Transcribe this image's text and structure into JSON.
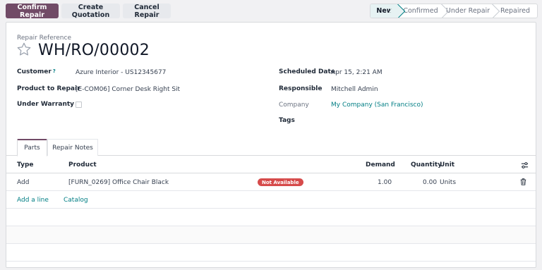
{
  "control_bar": {
    "confirm_label": "Confirm Repair",
    "create_quotation_label": "Create Quotation",
    "cancel_label": "Cancel Repair"
  },
  "status_stages": [
    "New",
    "Confirmed",
    "Under Repair",
    "Repaired"
  ],
  "active_stage": "New",
  "form": {
    "ref_label": "Repair Reference",
    "reference": "WH/RO/00002",
    "left_fields": {
      "customer_label": "Customer",
      "customer_value": "Azure Interior - US12345677",
      "product_label": "Product to Repair",
      "product_value": "[E-COM06] Corner Desk Right Sit",
      "warranty_label": "Under Warranty",
      "warranty_checked": false,
      "help_mark": "?"
    },
    "right_fields": {
      "scheduled_label": "Scheduled Date",
      "scheduled_value": "Apr 15, 2:21 AM",
      "responsible_label": "Responsible",
      "responsible_value": "Mitchell Admin",
      "company_label": "Company",
      "company_value": "My Company (San Francisco)",
      "tags_label": "Tags"
    }
  },
  "tabs": [
    "Parts",
    "Repair Notes"
  ],
  "table": {
    "headers": {
      "type": "Type",
      "product": "Product",
      "demand": "Demand",
      "quantity": "Quantity",
      "unit": "Unit"
    },
    "rows": [
      {
        "type": "Add",
        "product": "[FURN_0269] Office Chair Black",
        "badge": "Not Available",
        "demand": "1.00",
        "quantity": "0.00",
        "unit": "Units"
      }
    ],
    "add_line": "Add a line",
    "catalog": "Catalog"
  },
  "colors": {
    "brand": "#714b67",
    "link": "#017e84",
    "badge_danger": "#d64b4b"
  },
  "icons": [
    "star-icon",
    "column-settings-icon",
    "trash-icon"
  ]
}
